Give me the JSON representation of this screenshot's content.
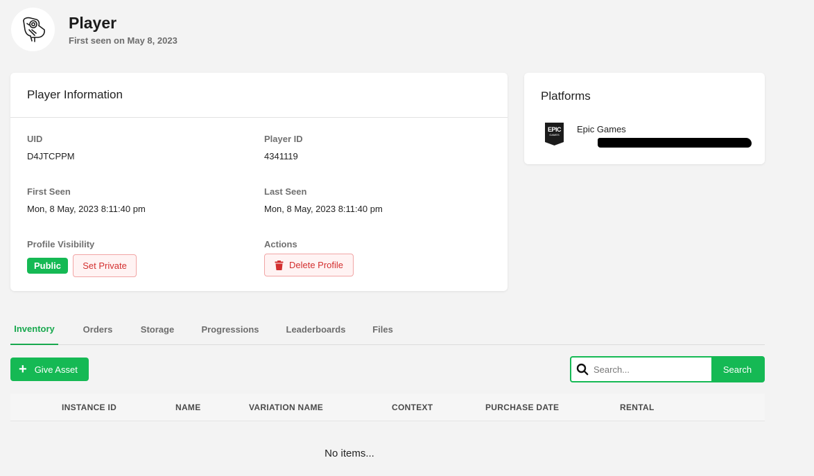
{
  "header": {
    "title": "Player",
    "subtitle": "First seen on May 8, 2023",
    "avatar_icon": "toucan-icon"
  },
  "info_card": {
    "title": "Player Information",
    "fields": {
      "uid": {
        "label": "UID",
        "value": "D4JTCPPM"
      },
      "player_id": {
        "label": "Player ID",
        "value": "4341119"
      },
      "first_seen": {
        "label": "First Seen",
        "value": "Mon, 8 May, 2023 8:11:40 pm"
      },
      "last_seen": {
        "label": "Last Seen",
        "value": "Mon, 8 May, 2023 8:11:40 pm"
      },
      "visibility": {
        "label": "Profile Visibility",
        "badge": "Public",
        "action": "Set Private"
      },
      "actions": {
        "label": "Actions",
        "delete": "Delete Profile"
      }
    }
  },
  "platforms": {
    "title": "Platforms",
    "items": [
      {
        "name": "Epic Games",
        "logo_line1": "EPIC",
        "logo_line2": "GAMES",
        "icon": "epic-games-logo"
      }
    ]
  },
  "tabs": [
    "Inventory",
    "Orders",
    "Storage",
    "Progressions",
    "Leaderboards",
    "Files"
  ],
  "toolbar": {
    "give_asset": "Give Asset",
    "search_placeholder": "Search...",
    "search_button": "Search"
  },
  "table": {
    "columns": [
      "INSTANCE ID",
      "NAME",
      "VARIATION NAME",
      "CONTEXT",
      "PURCHASE DATE",
      "RENTAL"
    ],
    "empty_message": "No items..."
  },
  "colors": {
    "accent": "#15b954",
    "danger": "#d32f2f",
    "background": "#f3f3f3"
  }
}
